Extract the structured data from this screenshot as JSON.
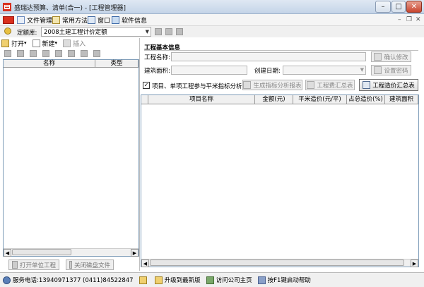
{
  "window": {
    "title": "盛瑞达预算、清单(合一) - [工程管理器]"
  },
  "menu": {
    "items": [
      {
        "label": "文件管理",
        "icon": "file-manage-icon"
      },
      {
        "label": "常用方法",
        "icon": "methods-icon"
      },
      {
        "label": "窗口",
        "icon": "window-icon"
      },
      {
        "label": "软件信息",
        "icon": "info-icon"
      }
    ]
  },
  "quota": {
    "label": "定额库:",
    "value": "2008土建工程计价定额"
  },
  "left_toolbar": {
    "open": "打开",
    "new": "新建",
    "insert": "插入"
  },
  "tree": {
    "columns": [
      "名称",
      "类型"
    ]
  },
  "left_buttons": {
    "open_unit": "打开单位工程",
    "close_disk": "关闭磁盘文件"
  },
  "project_info": {
    "group_title": "工程基本信息",
    "name_label": "工程名称:",
    "area_label": "建筑面积:",
    "date_label": "创建日期:",
    "confirm_edit": "确认修改",
    "set_password": "设置密码"
  },
  "analysis": {
    "checkbox_label": "项目、单项工程参与平米指标分析",
    "checked": true,
    "gen_report": "生成指标分析报表",
    "fee_summary": "工程费汇总表",
    "cost_summary": "工程造价汇总表"
  },
  "grid": {
    "columns": [
      "项目名称",
      "金额(元)",
      "平米造价(元/平)",
      "占总造价(%)",
      "建筑面积"
    ]
  },
  "status": {
    "phone": "服务电话:13940971377  (0411)84522847",
    "upgrade": "升级到最新版",
    "homepage": "访问公司主页",
    "help": "按F1键启动帮助"
  },
  "colors": {
    "accent": "#c4d4e8",
    "border": "#7f9db9",
    "close": "#c8452e"
  }
}
